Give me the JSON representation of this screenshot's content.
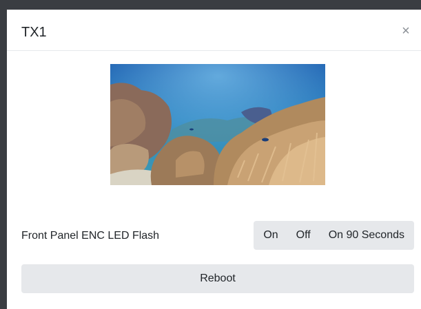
{
  "modal": {
    "title": "TX1",
    "close_glyph": "×"
  },
  "preview": {
    "image_subject": "underwater coral reef"
  },
  "settings": {
    "front_panel": {
      "label": "Front Panel ENC LED Flash",
      "options": [
        "On",
        "Off",
        "On 90 Seconds"
      ]
    }
  },
  "actions": {
    "reboot_label": "Reboot"
  },
  "colors": {
    "button_bg": "#e6e8eb",
    "text": "#212529",
    "backdrop": "#3a3d42"
  }
}
